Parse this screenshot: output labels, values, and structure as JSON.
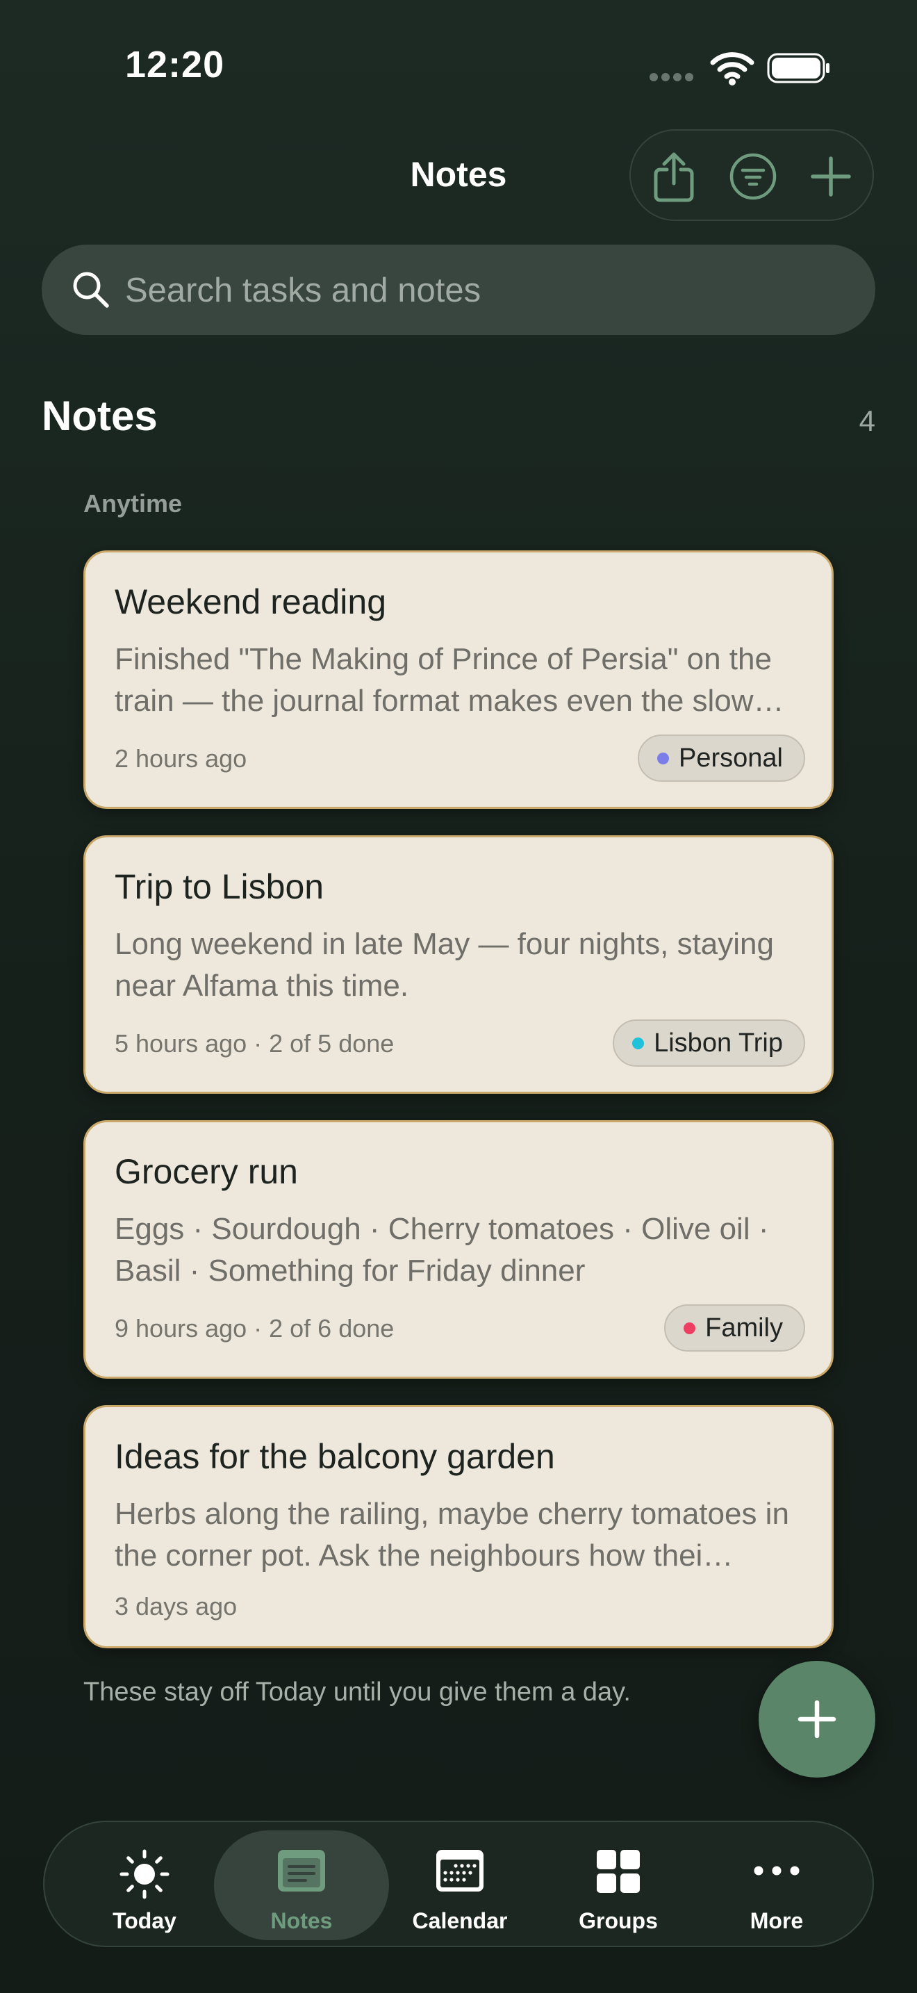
{
  "status_bar": {
    "time": "12:20"
  },
  "header": {
    "title": "Notes"
  },
  "toolbar": {
    "share_icon": "share-icon",
    "filter_icon": "filter-icon",
    "add_icon": "plus-icon"
  },
  "search": {
    "placeholder": "Search tasks and notes",
    "value": ""
  },
  "section": {
    "title": "Notes",
    "count": "4",
    "group_label": "Anytime"
  },
  "notes": [
    {
      "title": "Weekend reading",
      "body": "Finished \"The Making of Prince of Persia\" on the train — the journal format makes even the slow…",
      "meta": "2 hours ago",
      "tag": "Personal",
      "tag_color": "#7b7de8"
    },
    {
      "title": "Trip to Lisbon",
      "body": "Long weekend in late May — four nights, staying near Alfama this time.",
      "meta": "5 hours ago · 2 of 5 done",
      "tag": "Lisbon Trip",
      "tag_color": "#1fc2da"
    },
    {
      "title": "Grocery run",
      "body": "Eggs · Sourdough · Cherry tomatoes · Olive oil · Basil · Something for Friday dinner",
      "meta": "9 hours ago · 2 of 6 done",
      "tag": "Family",
      "tag_color": "#ee3f63"
    },
    {
      "title": "Ideas for the balcony garden",
      "body": "Herbs along the railing, maybe cherry tomatoes in the corner pot. Ask the neighbours how thei…",
      "meta": "3 days ago"
    }
  ],
  "footer_note": "These stay off Today until you give them a day.",
  "colors": {
    "accent": "#5a8568",
    "card_bg": "#eee8dc",
    "card_border": "#c9a86a",
    "active_tab_label": "#6f9c7e"
  },
  "tabbar": {
    "items": [
      {
        "label": "Today",
        "icon": "sun-icon"
      },
      {
        "label": "Notes",
        "icon": "notes-icon",
        "active": true
      },
      {
        "label": "Calendar",
        "icon": "calendar-icon"
      },
      {
        "label": "Groups",
        "icon": "groups-icon"
      },
      {
        "label": "More",
        "icon": "more-icon"
      }
    ]
  }
}
